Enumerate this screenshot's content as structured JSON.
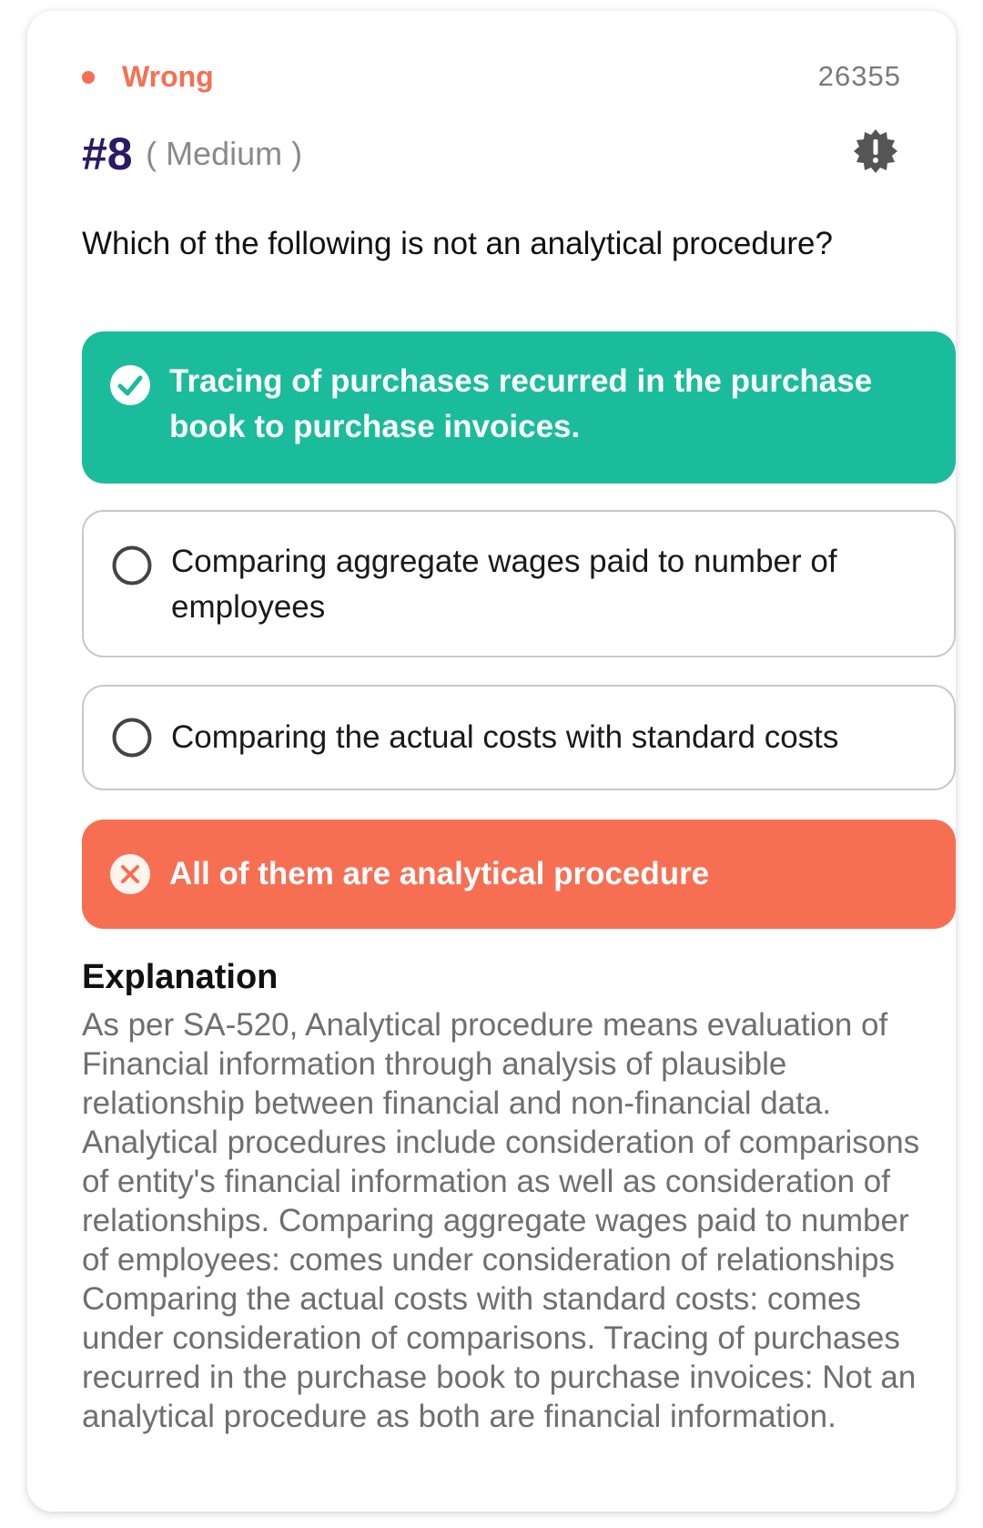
{
  "status": {
    "label": "Wrong",
    "color": "#f76f53",
    "dot_icon": "status-dot"
  },
  "question_id": "26355",
  "question": {
    "number": "#8",
    "difficulty": "( Medium )",
    "text": "Which of the following is not an analytical procedure?",
    "report_icon": "report-badge-icon"
  },
  "options": [
    {
      "text": "Tracing of purchases recurred in the purchase book to purchase invoices.",
      "state": "correct",
      "icon": "check-circle-icon",
      "color": "#1abc9c"
    },
    {
      "text": "Comparing aggregate wages paid to number of employees",
      "state": "unselected",
      "icon": "radio-empty-icon"
    },
    {
      "text": "Comparing the actual costs with standard costs",
      "state": "unselected",
      "icon": "radio-empty-icon"
    },
    {
      "text": "All of them are analytical procedure",
      "state": "wrong",
      "icon": "x-circle-icon",
      "color": "#f76f53"
    }
  ],
  "explanation": {
    "title": "Explanation",
    "body": "As per SA-520, Analytical procedure means evaluation of Financial information through analysis of plausible relationship between financial and non-financial data. Analytical procedures include consideration of comparisons of entity's financial information as well as consideration of relationships. Comparing aggregate wages paid to number of employees: comes under consideration of relationships Comparing the actual costs with standard costs: comes under consideration of comparisons. Tracing of purchases recurred in the purchase book to purchase invoices: Not an analytical procedure as both are financial information."
  }
}
